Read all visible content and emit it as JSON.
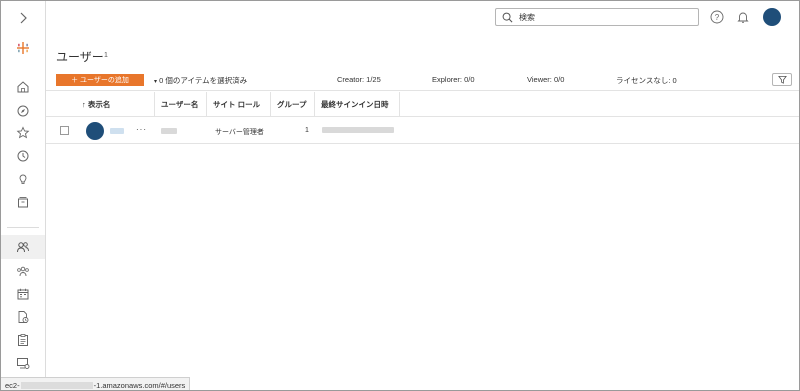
{
  "sidebar": {
    "items": [
      {
        "name": "expand-icon"
      },
      {
        "name": "tableau-logo-icon"
      },
      {
        "name": "home-icon"
      },
      {
        "name": "explore-icon"
      },
      {
        "name": "favorites-icon"
      },
      {
        "name": "recents-icon"
      },
      {
        "name": "recommendations-icon"
      },
      {
        "name": "collections-icon"
      },
      {
        "name": "users-icon"
      },
      {
        "name": "groups-icon"
      },
      {
        "name": "schedules-icon"
      },
      {
        "name": "tasks-icon"
      },
      {
        "name": "jobs-icon"
      },
      {
        "name": "site-settings-icon"
      }
    ]
  },
  "header": {
    "search_placeholder": "検索"
  },
  "page": {
    "title": "ユーザー",
    "count": "1"
  },
  "toolbar": {
    "add_user_label": "＋ ユーザーの追加",
    "selection_label": "0 個のアイテムを選択済み",
    "creator": "Creator: 1/25",
    "explorer": "Explorer: 0/0",
    "viewer": "Viewer: 0/0",
    "unlicensed": "ライセンスなし: 0"
  },
  "table": {
    "columns": [
      "↑ 表示名",
      "ユーザー名",
      "サイト ロール",
      "グループ",
      "最終サインイン日時"
    ],
    "rows": [
      {
        "site_role": "サーバー管理者",
        "groups": "1",
        "more": "···"
      }
    ]
  },
  "status_bar": {
    "url_start": "ec2-",
    "url_end": "-1.amazonaws.com/#/users"
  },
  "colors": {
    "accent": "#e8762b",
    "avatar": "#1f4e79"
  }
}
